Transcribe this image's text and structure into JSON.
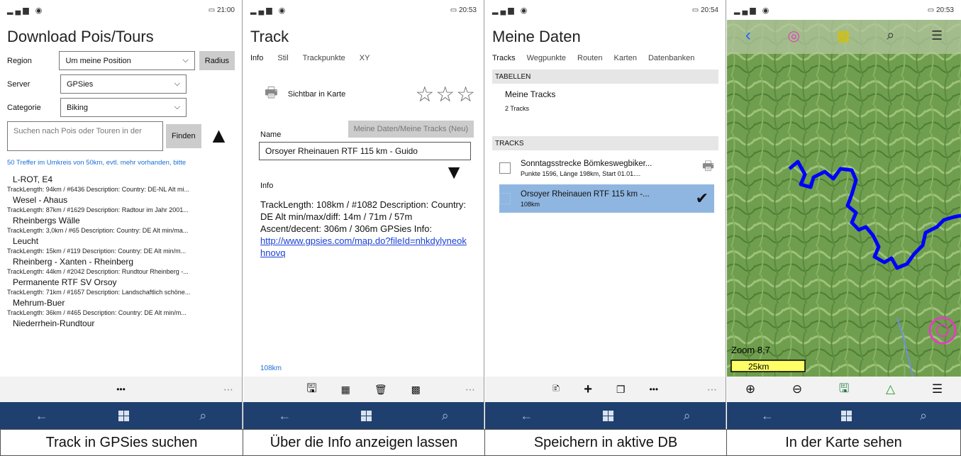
{
  "panels": [
    {
      "status": {
        "signal": "▂▄▆ ◉",
        "battery": "▭",
        "time": "21:00"
      },
      "title": "Download Pois/Tours",
      "region": {
        "label": "Region",
        "value": "Um meine Position",
        "button": "Radius"
      },
      "server": {
        "label": "Server",
        "value": "GPSies"
      },
      "category": {
        "label": "Categorie",
        "value": "Biking"
      },
      "search": {
        "placeholder": "Suchen nach Pois oder Touren in der",
        "button": "Finden"
      },
      "hint": "50 Treffer im Umkreis von 50km, evtl. mehr vorhanden, bitte",
      "results": [
        {
          "title": "L-ROT, E4",
          "desc": "TrackLength: 94km / #6436 Description: Country: DE-NL Alt mi..."
        },
        {
          "title": "Wesel - Ahaus",
          "desc": "TrackLength: 87km / #1629 Description: Radtour im Jahr 2001..."
        },
        {
          "title": "Rheinbergs Wälle",
          "desc": "TrackLength: 3,0km / #65 Description: Country: DE Alt min/ma..."
        },
        {
          "title": "Leucht",
          "desc": "TrackLength: 15km / #119 Description: Country: DE Alt min/m..."
        },
        {
          "title": "Rheinberg - Xanten - Rheinberg",
          "desc": "TrackLength: 44km / #2042 Description: Rundtour Rheinberg -..."
        },
        {
          "title": "Permanente RTF SV Orsoy",
          "desc": "TrackLength: 71km / #1657 Description: Landschaftlich schöne..."
        },
        {
          "title": "Mehrum-Buer",
          "desc": "TrackLength: 36km / #465 Description: Country: DE Alt min/m..."
        },
        {
          "title": "Niederrhein-Rundtour",
          "desc": ""
        }
      ],
      "appbar_more": "•••",
      "caption": "Track in GPSies suchen"
    },
    {
      "status": {
        "signal": "▂▄▆ ◉",
        "battery": "▭",
        "time": "20:53"
      },
      "title": "Track",
      "tabs": [
        "Info",
        "Stil",
        "Trackpunkte",
        "XY"
      ],
      "visible_label": "Sichtbar in Karte",
      "stars": "☆☆☆",
      "name_label": "Name",
      "save_target": "Meine Daten/Meine Tracks (Neu)",
      "name_value": "Orsoyer Rheinauen RTF 115 km - Guido",
      "info_label": "Info",
      "info_text": "TrackLength: 108km / #1082 Description: Country: DE Alt min/max/diff: 14m / 71m / 57m Ascent/decent: 306m / 306m GPSies Info:",
      "info_link": "http://www.gpsies.com/map.do?fileId=nhkdylyneokhnovq",
      "length": "108km",
      "caption": "Über die Info anzeigen lassen"
    },
    {
      "status": {
        "signal": "▂▄▆ ◉",
        "battery": "▭",
        "time": "20:54"
      },
      "title": "Meine Daten",
      "tabs": [
        "Tracks",
        "Wegpunkte",
        "Routen",
        "Karten",
        "Datenbanken"
      ],
      "tables_head": "TABELLEN",
      "table_name": "Meine Tracks",
      "table_count": "2 Tracks",
      "tracks_head": "TRACKS",
      "tracks": [
        {
          "name": "Sonntagsstrecke Bömkeswegbiker...",
          "sub": "Punkte 1596, Länge 198km, Start 01.01...."
        },
        {
          "name": "Orsoyer Rheinauen RTF 115 km -...",
          "sub": "108km"
        }
      ],
      "appbar_more": "•••",
      "caption": "Speichern in aktive DB"
    },
    {
      "status": {
        "signal": "▂▄▆ ◉",
        "battery": "▭",
        "time": "20:53"
      },
      "zoom": "Zoom 8,7",
      "scale": "25km",
      "caption": "In der Karte sehen"
    }
  ],
  "colors": {
    "nav": "#1f3f6e",
    "selected": "#8fb6e0",
    "track": "#0000ff",
    "pink": "#e040c0"
  }
}
